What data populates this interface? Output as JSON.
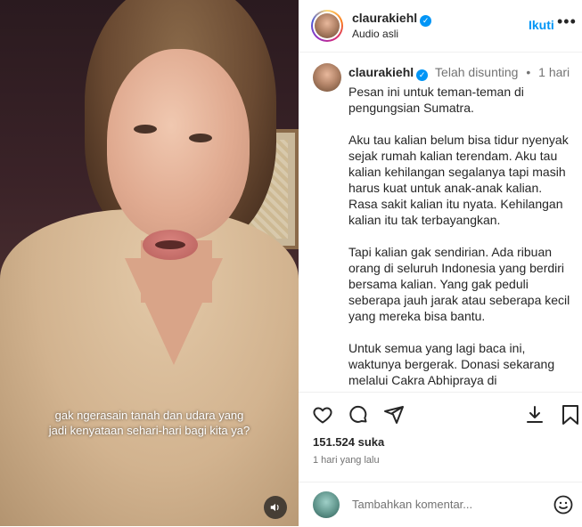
{
  "video": {
    "subtitle_line1": "gak ngerasain tanah dan udara yang",
    "subtitle_line2": "jadi kenyataan sehari-hari bagi kita ya?",
    "audio_icon": "speaker-icon"
  },
  "header": {
    "username": "claurakiehl",
    "audio_label": "Audio asli",
    "follow_label": "Ikuti",
    "more_label": "•••"
  },
  "caption": {
    "username": "claurakiehl",
    "edited_label": "Telah disunting",
    "separator": "•",
    "age": "1 hari",
    "paragraphs": [
      "Pesan ini untuk teman-teman di pengungsian Sumatra.",
      "Aku tau kalian belum bisa tidur nyenyak sejak rumah kalian terendam. Aku tau kalian kehilangan segalanya tapi masih harus kuat untuk anak-anak kalian. Rasa sakit kalian itu nyata. Kehilangan kalian itu tak terbayangkan.",
      "Tapi kalian gak sendirian. Ada ribuan orang di seluruh Indonesia yang berdiri bersama kalian. Yang gak peduli seberapa jauh jarak atau seberapa kecil yang mereka bisa bantu.",
      "Untuk semua yang lagi baca ini, waktunya bergerak. Donasi sekarang melalui Cakra Abhipraya di"
    ]
  },
  "stats": {
    "likes": "151.524 suka",
    "posted": "1 hari yang lalu"
  },
  "comment": {
    "placeholder": "Tambahkan komentar..."
  },
  "colors": {
    "link_blue": "#0095f6",
    "muted": "#737373",
    "text": "#262626"
  }
}
